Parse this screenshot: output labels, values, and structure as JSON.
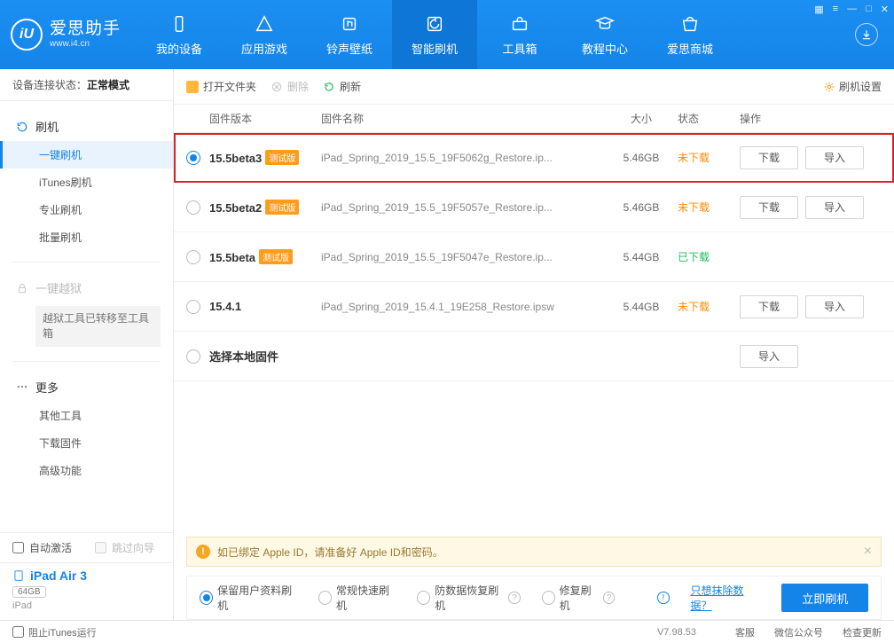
{
  "app": {
    "name_cn": "爱思助手",
    "name_en": "www.i4.cn"
  },
  "nav": {
    "items": [
      {
        "label": "我的设备"
      },
      {
        "label": "应用游戏"
      },
      {
        "label": "铃声壁纸"
      },
      {
        "label": "智能刷机"
      },
      {
        "label": "工具箱"
      },
      {
        "label": "教程中心"
      },
      {
        "label": "爱思商城"
      }
    ]
  },
  "sidebar": {
    "conn_label": "设备连接状态：",
    "conn_value": "正常模式",
    "groups": {
      "flash": {
        "title": "刷机",
        "items": [
          "一键刷机",
          "iTunes刷机",
          "专业刷机",
          "批量刷机"
        ]
      },
      "jailbreak": {
        "title": "一键越狱",
        "note": "越狱工具已转移至工具箱"
      },
      "more": {
        "title": "更多",
        "items": [
          "其他工具",
          "下载固件",
          "高级功能"
        ]
      }
    },
    "auto_activate": "自动激活",
    "skip_guide": "跳过向导",
    "device": {
      "name": "iPad Air 3",
      "capacity": "64GB",
      "type": "iPad"
    }
  },
  "toolbar": {
    "open": "打开文件夹",
    "delete": "删除",
    "refresh": "刷新",
    "settings": "刷机设置"
  },
  "table": {
    "headers": {
      "ver": "固件版本",
      "name": "固件名称",
      "size": "大小",
      "state": "状态",
      "ops": "操作"
    },
    "rows": [
      {
        "ver": "15.5beta3",
        "beta": "测试版",
        "name": "iPad_Spring_2019_15.5_19F5062g_Restore.ip...",
        "size": "5.46GB",
        "state": "未下载",
        "state_cls": "orange",
        "dl": true,
        "imp": true,
        "selected": true
      },
      {
        "ver": "15.5beta2",
        "beta": "测试版",
        "name": "iPad_Spring_2019_15.5_19F5057e_Restore.ip...",
        "size": "5.46GB",
        "state": "未下载",
        "state_cls": "orange",
        "dl": true,
        "imp": true
      },
      {
        "ver": "15.5beta",
        "beta": "测试版",
        "name": "iPad_Spring_2019_15.5_19F5047e_Restore.ip...",
        "size": "5.44GB",
        "state": "已下载",
        "state_cls": "green",
        "dl": false,
        "imp": false
      },
      {
        "ver": "15.4.1",
        "beta": "",
        "name": "iPad_Spring_2019_15.4.1_19E258_Restore.ipsw",
        "size": "5.44GB",
        "state": "未下载",
        "state_cls": "orange",
        "dl": true,
        "imp": true
      },
      {
        "ver": "选择本地固件",
        "beta": "",
        "name": "",
        "size": "",
        "state": "",
        "state_cls": "",
        "dl": false,
        "imp": true
      }
    ],
    "btn_dl": "下载",
    "btn_imp": "导入"
  },
  "alert": "如已绑定 Apple ID，请准备好 Apple ID和密码。",
  "options": {
    "items": [
      "保留用户资料刷机",
      "常规快速刷机",
      "防数据恢复刷机",
      "修复刷机"
    ],
    "link": "只想抹除数据？",
    "action": "立即刷机"
  },
  "status": {
    "block_itunes": "阻止iTunes运行",
    "version": "V7.98.53",
    "links": [
      "客服",
      "微信公众号",
      "检查更新"
    ]
  }
}
